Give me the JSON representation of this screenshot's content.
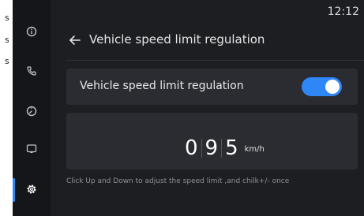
{
  "left_strip": {
    "chars": [
      "s",
      "s",
      "s"
    ]
  },
  "sidebar": {
    "items": [
      {
        "icon": "info-icon"
      },
      {
        "icon": "phone-icon"
      },
      {
        "icon": "gauge-icon"
      },
      {
        "icon": "screen-icon"
      },
      {
        "icon": "gear-icon",
        "active": true
      }
    ]
  },
  "status": {
    "time": "12:12"
  },
  "header": {
    "title": "Vehicle speed limit regulation"
  },
  "toggle_card": {
    "label": "Vehicle speed limit regulation",
    "enabled": true
  },
  "speed": {
    "digits": [
      "0",
      "9",
      "5"
    ],
    "unit": "km/h"
  },
  "hint": "Click Up and Down to adjust the speed limit ,and chilk+/- once",
  "colors": {
    "accent": "#2f86f6",
    "background": "#1d1e22",
    "card": "#2a2c31",
    "sidebar": "#151619"
  }
}
